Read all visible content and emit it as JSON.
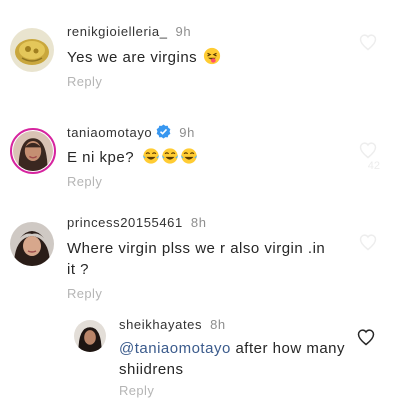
{
  "comments": [
    {
      "username": "renikgioielleria_",
      "time": "9h",
      "text": "Yes we are virgins",
      "emoji": "squinting-tongue-emoji",
      "reply_label": "Reply"
    },
    {
      "username": "taniaomotayo",
      "verified": true,
      "time": "9h",
      "text": "E ni kpe?",
      "emoji": "tears-of-joy-emoji",
      "reply_label": "Reply",
      "like_count": "42"
    },
    {
      "username": "princess20155461",
      "time": "8h",
      "text_line1": "Where virgin plss we r also virgin .in",
      "text_line2": "it ?",
      "reply_label": "Reply"
    },
    {
      "username": "sheikhayates",
      "time": "8h",
      "mention": "@taniaomotayo",
      "text_line1": " after how many",
      "text_line2": "shiidrens",
      "reply_label": "Reply"
    }
  ],
  "icons": {
    "like": "heart-outline-icon",
    "verified": "verified-badge-icon"
  },
  "colors": {
    "username": "#333333",
    "time": "#8e8e8e",
    "reply": "#b5b5b5",
    "mention": "#3b5b8c",
    "verified": "#3897f0"
  }
}
